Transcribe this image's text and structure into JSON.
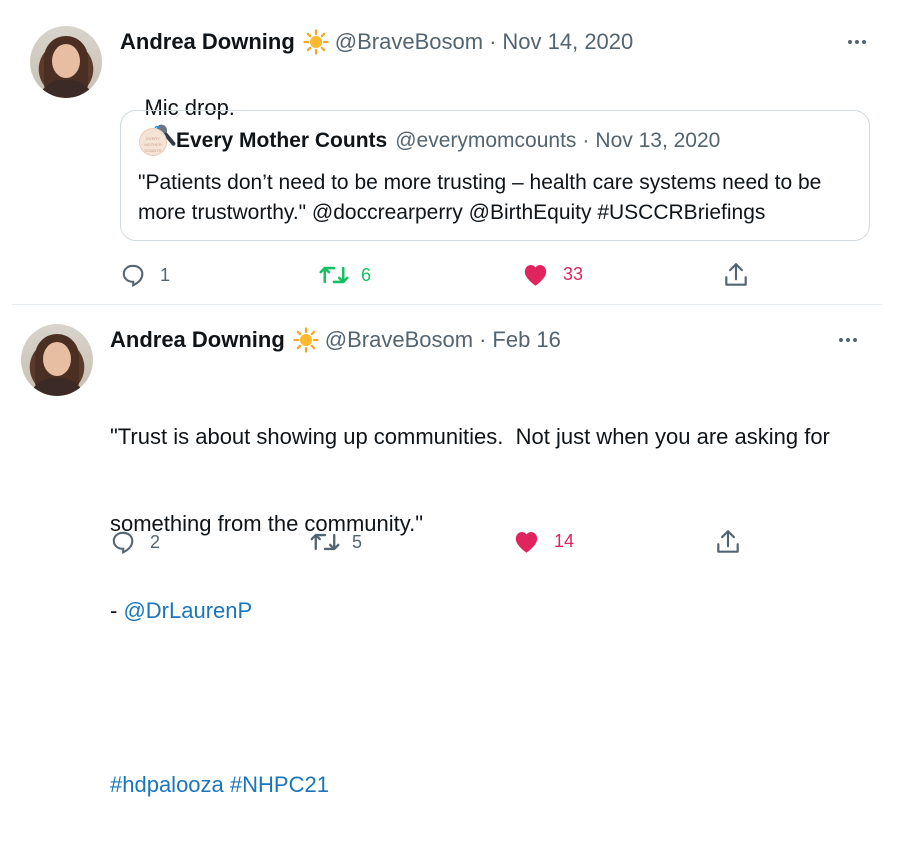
{
  "tweets": [
    {
      "author": {
        "name": "Andrea Downing",
        "handle": "@BraveBosom"
      },
      "date": "Nov 14, 2020",
      "text": "Mic drop.",
      "emoji": "microphone",
      "quoted": {
        "author": {
          "name": "Every Mother Counts",
          "handle": "@everymomcounts"
        },
        "date": "Nov 13, 2020",
        "avatar_text": "EVERY MOTHER COUNTS",
        "text_plain": "\"Patients don’t need to be more trusting – health care systems need to be more trustworthy.\" @doccrearperry @BirthEquity #USCCRBriefings"
      },
      "stats": {
        "replies": "1",
        "retweets": "6",
        "likes": "33"
      },
      "retweeted": true,
      "liked": true
    },
    {
      "author": {
        "name": "Andrea Downing",
        "handle": "@BraveBosom"
      },
      "date": "Feb 16",
      "text_line1": "\"Trust is about showing up communities.  Not just when you are asking for",
      "text_line2": "something from the community.\"",
      "text_line3_prefix": "- ",
      "mention": "@DrLaurenP",
      "hashtags": "#hdpalooza #NHPC21",
      "stats": {
        "replies": "2",
        "retweets": "5",
        "likes": "14"
      },
      "retweeted": false,
      "liked": true
    }
  ],
  "colors": {
    "link": "#1b75bc",
    "like": "#e0245e",
    "retweet": "#17bf63",
    "muted": "#536471"
  },
  "icons": [
    "sun-emoji-icon",
    "microphone-emoji-icon",
    "more-icon",
    "reply-icon",
    "retweet-icon",
    "like-icon",
    "share-icon"
  ]
}
